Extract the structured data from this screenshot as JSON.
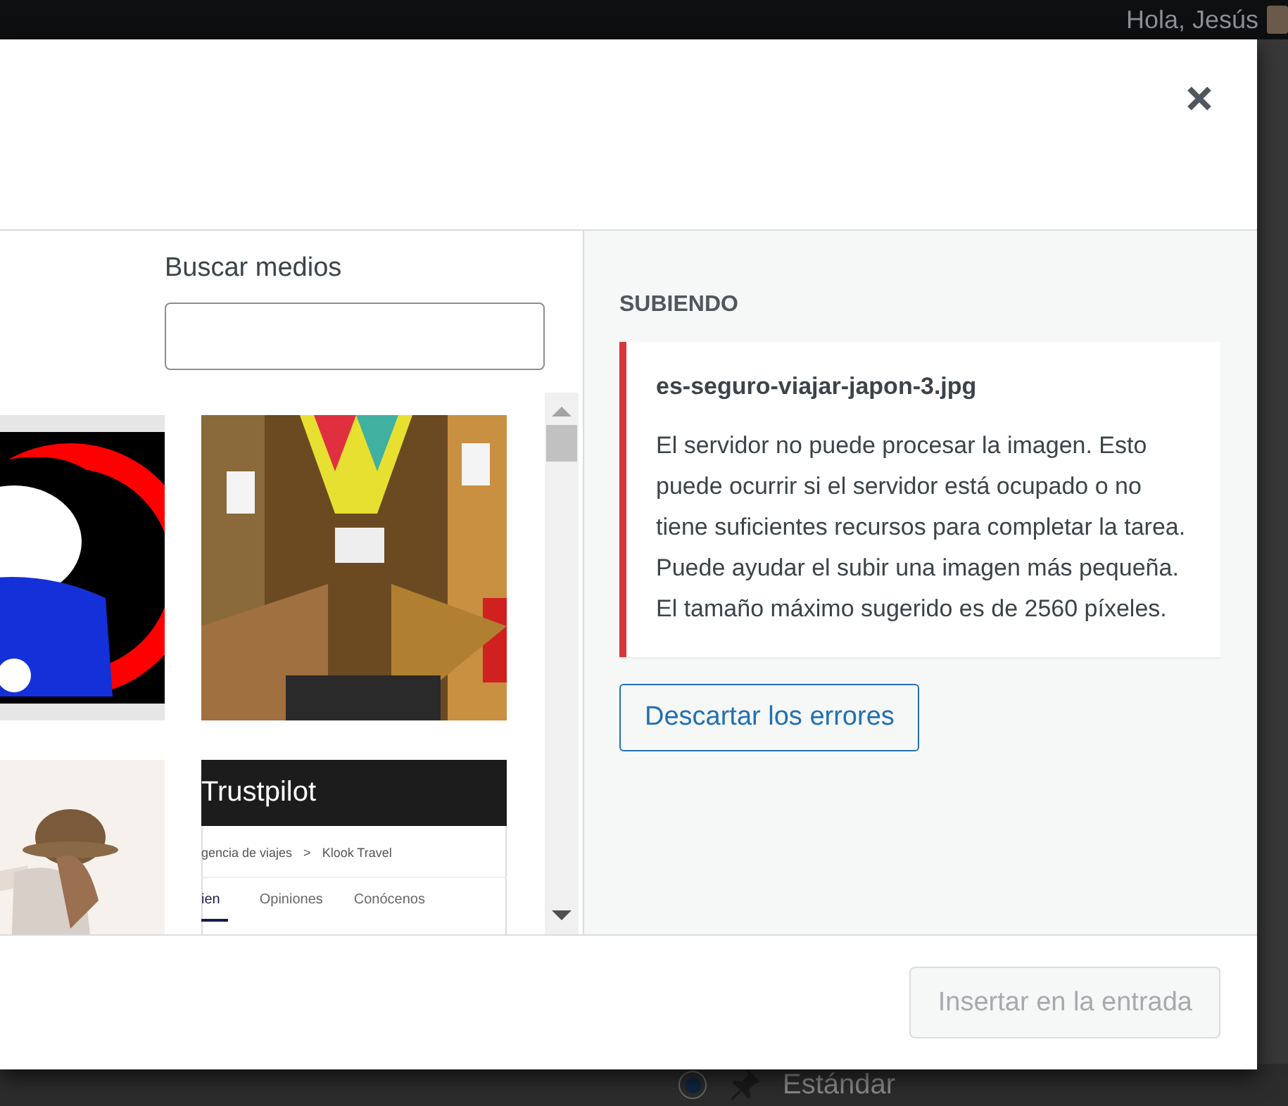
{
  "admin_bar": {
    "greeting": "Hola, Jesús"
  },
  "modal": {
    "search": {
      "label": "Buscar medios"
    },
    "media": [
      {
        "kind": "doll"
      },
      {
        "kind": "market"
      },
      {
        "kind": "traveler"
      },
      {
        "kind": "screenshot",
        "title": "Trustpilot",
        "breadcrumb": [
          "gencia de viajes",
          "Klook Travel"
        ],
        "separator": ">",
        "tabs": [
          {
            "label": "ien",
            "selected": true
          },
          {
            "label": "Opiniones",
            "selected": false
          },
          {
            "label": "Conócenos",
            "selected": false
          }
        ]
      }
    ],
    "uploading": {
      "heading": "SUBIENDO",
      "errors": [
        {
          "file": "es-seguro-viajar-japon-3.jpg",
          "message": "El servidor no puede procesar la imagen. Esto puede ocurrir si el servidor está ocupado o no tiene suficientes recursos para completar la tarea. Puede ayudar el subir una imagen más pequeña. El tamaño máximo sugerido es de 2560 píxeles."
        }
      ],
      "dismiss_button": "Descartar los errores"
    },
    "insert_button": {
      "label": "Insertar en la entrada",
      "disabled": true
    }
  },
  "background": {
    "post_format": {
      "label": "Estándar",
      "selected": true
    }
  }
}
